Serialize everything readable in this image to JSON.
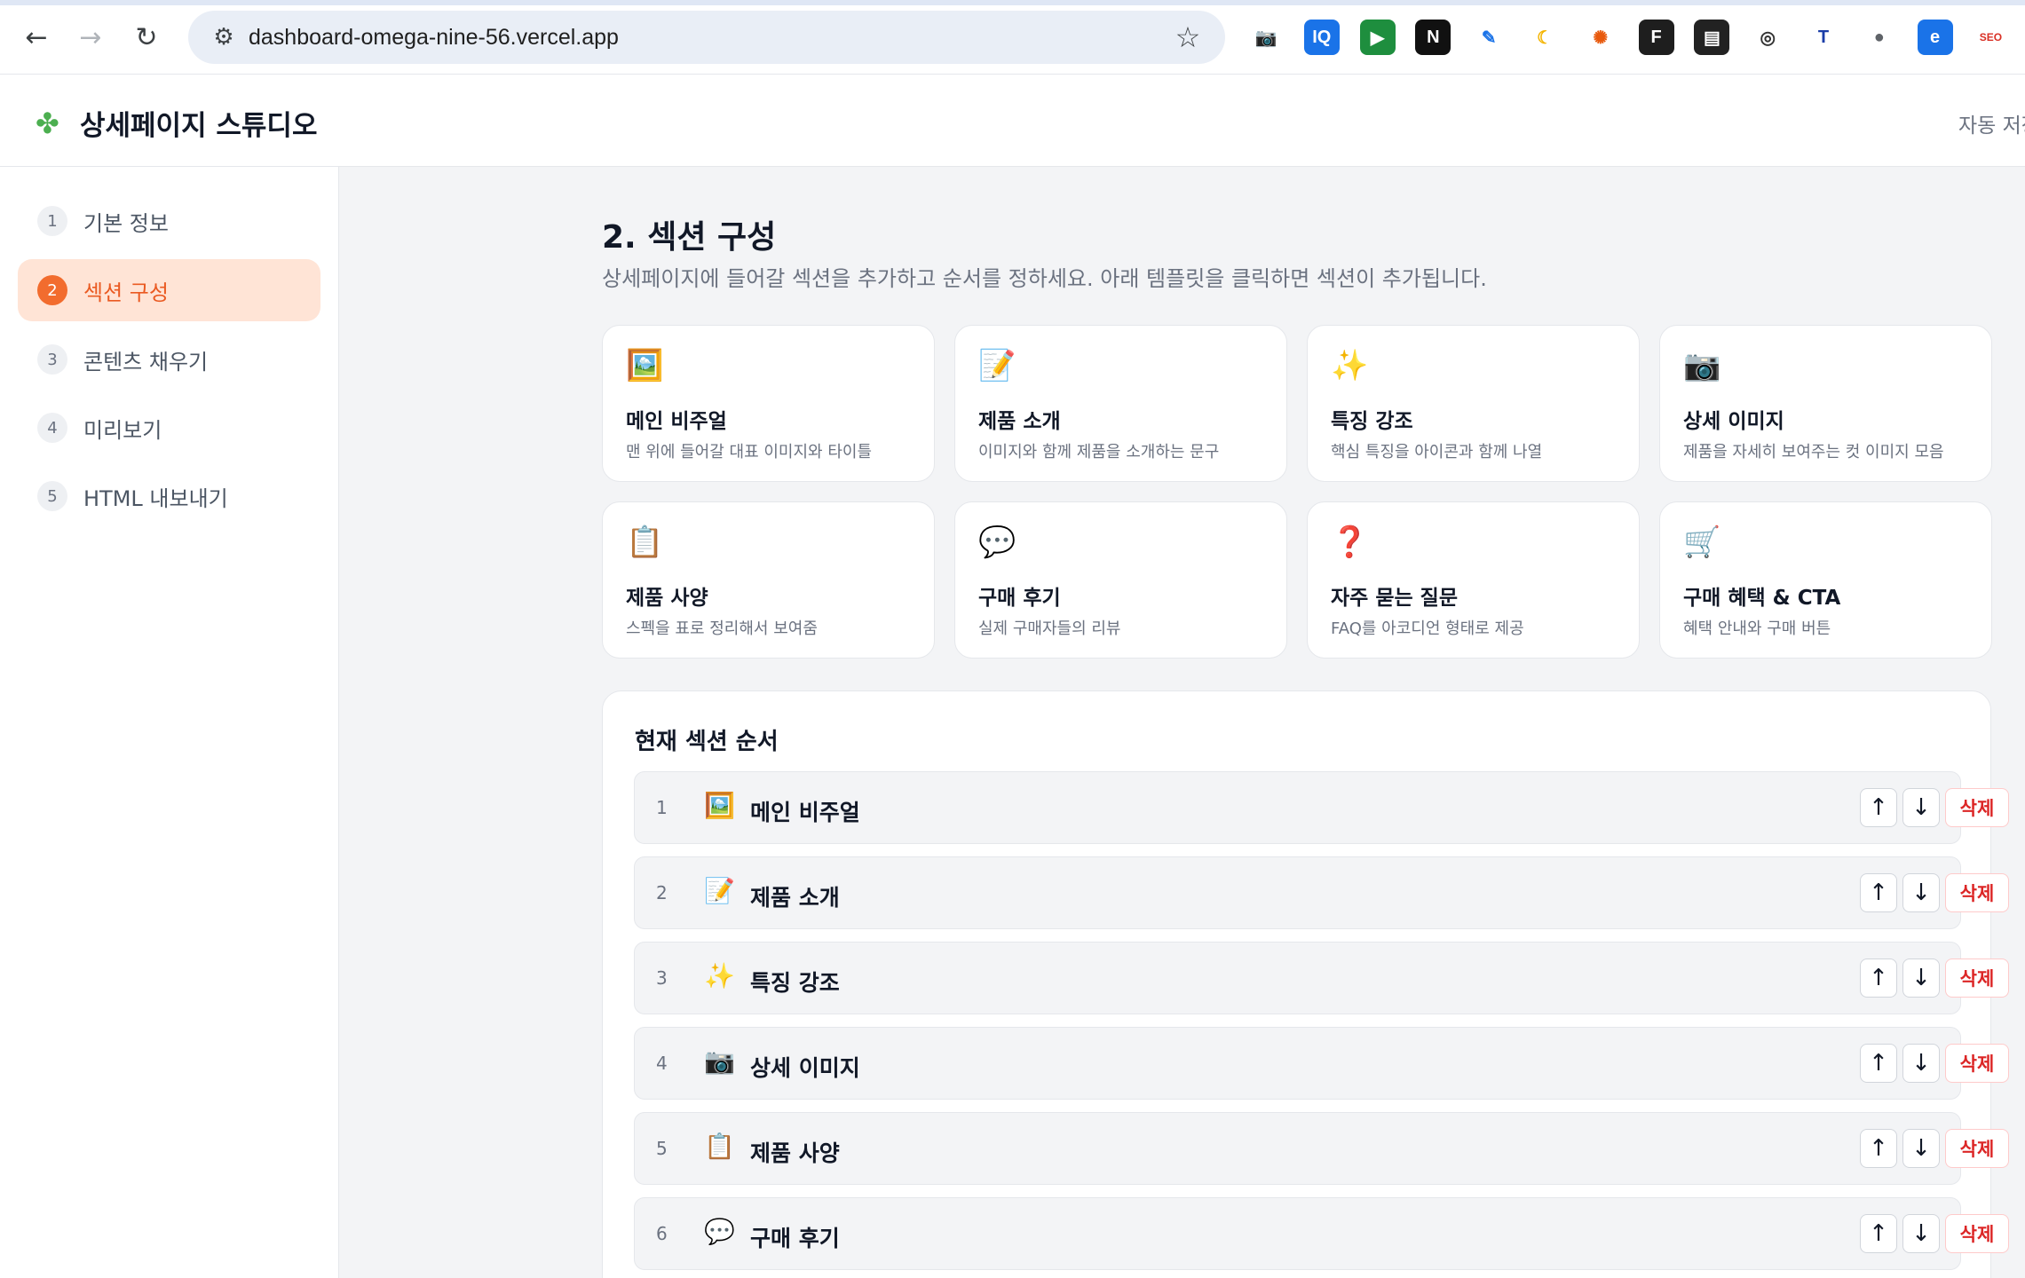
{
  "browser": {
    "url": "dashboard-omega-nine-56.vercel.app",
    "back_icon": "←",
    "forward_icon": "→",
    "reload_icon": "↻",
    "site_info_icon": "⚙",
    "star_icon": "☆",
    "extensions": [
      {
        "name": "camera-extension-icon",
        "glyph": "📷",
        "bg": "#ffffff",
        "fg": "#5f6368"
      },
      {
        "name": "iq-extension-icon",
        "glyph": "IQ",
        "bg": "#1a73e8",
        "fg": "#ffffff"
      },
      {
        "name": "play-extension-icon",
        "glyph": "▶",
        "bg": "#1e8e3e",
        "fg": "#ffffff"
      },
      {
        "name": "notion-extension-icon",
        "glyph": "N",
        "bg": "#111111",
        "fg": "#ffffff"
      },
      {
        "name": "bird-extension-icon",
        "glyph": "✎",
        "bg": "#ffffff",
        "fg": "#1a73e8"
      },
      {
        "name": "moon-extension-icon",
        "glyph": "☾",
        "bg": "#ffffff",
        "fg": "#f4b400"
      },
      {
        "name": "burst-extension-icon",
        "glyph": "✺",
        "bg": "#ffffff",
        "fg": "#e8590c"
      },
      {
        "name": "figma-extension-icon",
        "glyph": "F",
        "bg": "#1e1e1e",
        "fg": "#ffffff"
      },
      {
        "name": "terminal-extension-icon",
        "glyph": "▤",
        "bg": "#222222",
        "fg": "#ffffff"
      },
      {
        "name": "eye-off-extension-icon",
        "glyph": "◎",
        "bg": "#ffffff",
        "fg": "#333333"
      },
      {
        "name": "translate-extension-icon",
        "glyph": "T",
        "bg": "#ffffff",
        "fg": "#1a3da8"
      },
      {
        "name": "mouse-extension-icon",
        "glyph": "●",
        "bg": "#ffffff",
        "fg": "#5f6368"
      },
      {
        "name": "edge-extension-icon",
        "glyph": "e",
        "bg": "#1a73e8",
        "fg": "#ffffff"
      },
      {
        "name": "seo-extension-icon",
        "glyph": "SEO",
        "bg": "#ffffff",
        "fg": "#d93025"
      }
    ]
  },
  "app": {
    "logo_icon": "✤",
    "title": "상세페이지 스튜디오",
    "autosave": "자동 저장"
  },
  "sidebar": {
    "steps": [
      {
        "num": "1",
        "label": "기본 정보",
        "active": false
      },
      {
        "num": "2",
        "label": "섹션 구성",
        "active": true
      },
      {
        "num": "3",
        "label": "콘텐츠 채우기",
        "active": false
      },
      {
        "num": "4",
        "label": "미리보기",
        "active": false
      },
      {
        "num": "5",
        "label": "HTML 내보내기",
        "active": false
      }
    ]
  },
  "main": {
    "title": "2. 섹션 구성",
    "description": "상세페이지에 들어갈 섹션을 추가하고 순서를 정하세요. 아래 템플릿을 클릭하면 섹션이 추가됩니다.",
    "templates": [
      {
        "icon": "🖼️",
        "icon_name": "picture-icon",
        "name": "메인 비주얼",
        "desc": "맨 위에 들어갈 대표 이미지와 타이틀"
      },
      {
        "icon": "📝",
        "icon_name": "memo-icon",
        "name": "제품 소개",
        "desc": "이미지와 함께 제품을 소개하는 문구"
      },
      {
        "icon": "✨",
        "icon_name": "sparkles-icon",
        "name": "특징 강조",
        "desc": "핵심 특징을 아이콘과 함께 나열"
      },
      {
        "icon": "📷",
        "icon_name": "camera-icon",
        "name": "상세 이미지",
        "desc": "제품을 자세히 보여주는 컷 이미지 모음"
      },
      {
        "icon": "📋",
        "icon_name": "clipboard-icon",
        "name": "제품 사양",
        "desc": "스펙을 표로 정리해서 보여줌"
      },
      {
        "icon": "💬",
        "icon_name": "speech-bubble-icon",
        "name": "구매 후기",
        "desc": "실제 구매자들의 리뷰"
      },
      {
        "icon": "❓",
        "icon_name": "question-mark-icon",
        "name": "자주 묻는 질문",
        "desc": "FAQ를 아코디언 형태로 제공"
      },
      {
        "icon": "🛒",
        "icon_name": "shopping-cart-icon",
        "name": "구매 혜택 & CTA",
        "desc": "혜택 안내와 구매 버튼"
      }
    ],
    "order": {
      "title": "현재 섹션 순서",
      "up_label": "↑",
      "down_label": "↓",
      "delete_label": "삭제",
      "rows": [
        {
          "num": "1",
          "icon": "🖼️",
          "icon_name": "picture-icon",
          "name": "메인 비주얼"
        },
        {
          "num": "2",
          "icon": "📝",
          "icon_name": "memo-icon",
          "name": "제품 소개"
        },
        {
          "num": "3",
          "icon": "✨",
          "icon_name": "sparkles-icon",
          "name": "특징 강조"
        },
        {
          "num": "4",
          "icon": "📷",
          "icon_name": "camera-icon",
          "name": "상세 이미지"
        },
        {
          "num": "5",
          "icon": "📋",
          "icon_name": "clipboard-icon",
          "name": "제품 사양"
        },
        {
          "num": "6",
          "icon": "💬",
          "icon_name": "speech-bubble-icon",
          "name": "구매 후기"
        }
      ]
    }
  }
}
